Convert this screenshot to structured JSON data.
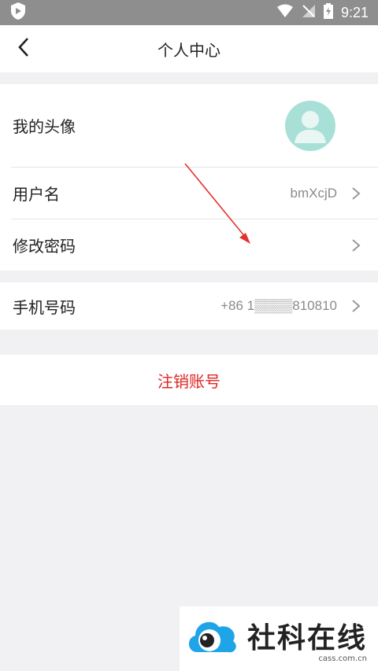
{
  "status_bar": {
    "time": "9:21"
  },
  "header": {
    "title": "个人中心"
  },
  "profile": {
    "avatar_label": "我的头像",
    "username_label": "用户名",
    "username_value": "bmXcjD",
    "password_label": "修改密码"
  },
  "phone": {
    "label": "手机号码",
    "value": "+86 1▒▒▒▒810810"
  },
  "logout": {
    "label": "注销账号"
  },
  "watermark": {
    "name": "社科在线",
    "site": "cass.com.cn"
  },
  "colors": {
    "accent_red": "#e02424",
    "avatar_bg": "#a8e0d7",
    "statusbar": "#8e8e8e",
    "background": "#f1f1f4"
  }
}
